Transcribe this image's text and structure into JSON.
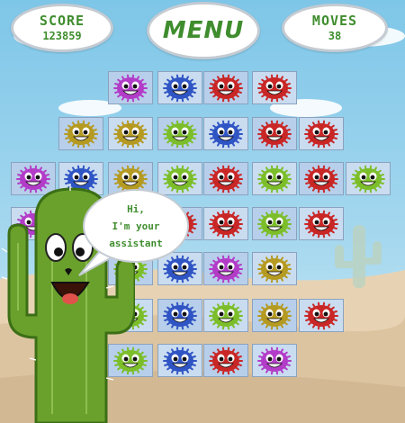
{
  "hud": {
    "score_label": "SCORE",
    "score_value": "123859",
    "menu_label": "MENU",
    "moves_label": "MOVES",
    "moves_value": "38"
  },
  "assistant": {
    "line1": "Hi,",
    "line2": "I'm your",
    "line3": "assistant"
  },
  "colors": {
    "purple": "#b23cc8",
    "blue": "#2f54c4",
    "red": "#c92626",
    "olive": "#b59a22",
    "green": "#7cbe2a",
    "text_green": "#3f8d2e"
  },
  "board": {
    "rows": [
      [
        "",
        "",
        "purple",
        "blue",
        "red",
        "red",
        "",
        ""
      ],
      [
        "",
        "olive",
        "olive",
        "green",
        "blue",
        "red",
        "red",
        ""
      ],
      [
        "purple",
        "blue",
        "olive",
        "green",
        "red",
        "green",
        "red",
        "green"
      ],
      [
        "purple",
        "purple",
        "olive",
        "red",
        "red",
        "green",
        "red",
        ""
      ],
      [
        "",
        "",
        "green",
        "blue",
        "purple",
        "olive",
        "",
        ""
      ],
      [
        "",
        "purple",
        "green",
        "blue",
        "green",
        "olive",
        "red",
        ""
      ],
      [
        "",
        "",
        "green",
        "blue",
        "red",
        "purple",
        "",
        ""
      ]
    ]
  }
}
